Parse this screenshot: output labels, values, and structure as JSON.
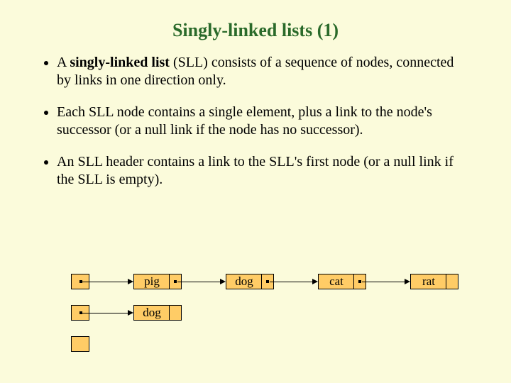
{
  "title": "Singly-linked lists (1)",
  "bullets": {
    "b1_pre": "A ",
    "b1_term": "singly-linked list",
    "b1_post": "  (SLL) consists of a sequence of nodes, connected by links in one direction only.",
    "b2": "Each SLL node contains a single element, plus a link to the node's successor (or a null link if the node has no successor).",
    "b3": "An SLL header contains a link to the SLL's first node (or a null link if the SLL is empty)."
  },
  "diagram": {
    "row1": {
      "nodes": [
        "pig",
        "dog",
        "cat",
        "rat"
      ]
    },
    "row2": {
      "nodes": [
        "dog"
      ]
    }
  }
}
